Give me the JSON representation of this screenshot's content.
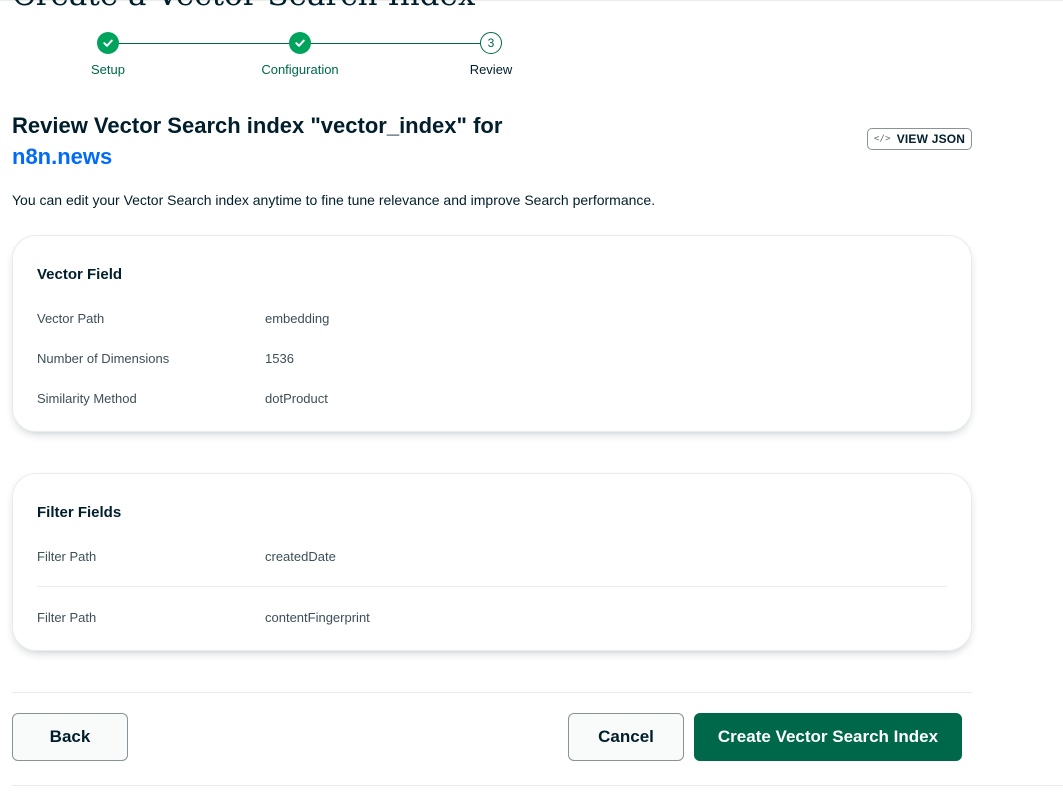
{
  "page_heading": "Create a Vector Search Index",
  "stepper": {
    "steps": [
      {
        "label": "Setup",
        "status": "complete"
      },
      {
        "label": "Configuration",
        "status": "complete"
      },
      {
        "label": "Review",
        "status": "current",
        "number": "3"
      }
    ]
  },
  "review": {
    "title": "Review Vector Search index \"vector_index\" for",
    "database_link": "n8n.news",
    "view_json_label": "VIEW JSON",
    "description": "You can edit your Vector Search index anytime to fine tune relevance and improve Search performance."
  },
  "vector_field": {
    "title": "Vector Field",
    "rows": [
      {
        "label": "Vector Path",
        "value": "embedding"
      },
      {
        "label": "Number of Dimensions",
        "value": "1536"
      },
      {
        "label": "Similarity Method",
        "value": "dotProduct"
      }
    ]
  },
  "filter_fields": {
    "title": "Filter Fields",
    "rows": [
      {
        "label": "Filter Path",
        "value": "createdDate"
      },
      {
        "label": "Filter Path",
        "value": "contentFingerprint"
      }
    ]
  },
  "footer": {
    "back_label": "Back",
    "cancel_label": "Cancel",
    "create_label": "Create Vector Search Index"
  },
  "colors": {
    "accent_green": "#00684a",
    "check_green": "#00a35c",
    "link_blue": "#016bf8",
    "text_dark": "#001e2b"
  }
}
